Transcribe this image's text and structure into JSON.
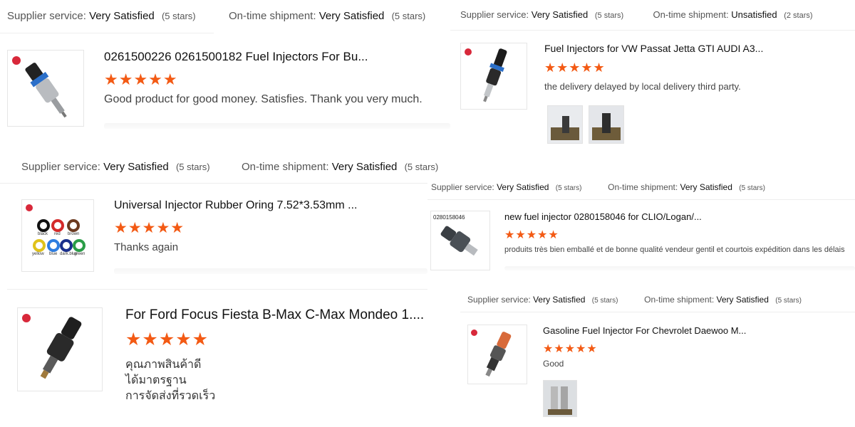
{
  "common": {
    "supplier_label": "Supplier service:",
    "shipment_label": "On-time shipment:",
    "very_satisfied": "Very Satisfied",
    "unsatisfied": "Unsatisfied",
    "five_stars_note": "(5 stars)",
    "two_stars_note": "(2 stars)",
    "star_glyphs": "★★★★★",
    "star_color": "#f35a14"
  },
  "reviews": [
    {
      "title": "0261500226 0261500182 Fuel Injectors For Bu...",
      "rating": 5,
      "text": "Good product for good money. Satisfies. Thank you very much.",
      "supplier": "Very Satisfied",
      "supplier_stars": "(5 stars)",
      "shipment": "Very Satisfied",
      "shipment_stars": "(5 stars)",
      "image_icon": "fuel-injector-silver-icon"
    },
    {
      "title": "Fuel Injectors for VW Passat Jetta GTI AUDI A3...",
      "rating": 5,
      "text": "the delivery delayed by local delivery third party.",
      "supplier": "Very Satisfied",
      "supplier_stars": "(5 stars)",
      "shipment": "Unsatisfied",
      "shipment_stars": "(2 stars)",
      "image_icon": "fuel-injector-black-icon",
      "photos": 2
    },
    {
      "title": "Universal Injector Rubber Oring 7.52*3.53mm ...",
      "rating": 5,
      "text": "Thanks again",
      "supplier": "Very Satisfied",
      "supplier_stars": "(5 stars)",
      "shipment": "Very Satisfied",
      "shipment_stars": "(5 stars)",
      "image_icon": "orings-icon",
      "oring_labels": [
        "black",
        "red",
        "brown",
        "yellow",
        "blue",
        "dark.blue",
        "green"
      ]
    },
    {
      "title": "new fuel injector 0280158046 for CLIO/Logan/...",
      "rating": 5,
      "text": "produits très bien emballé et de bonne qualité vendeur gentil et courtois expédition dans les délais",
      "supplier": "Very Satisfied",
      "supplier_stars": "(5 stars)",
      "shipment": "Very Satisfied",
      "shipment_stars": "(5 stars)",
      "image_icon": "fuel-injector-dark-icon",
      "image_caption": "0280158046"
    },
    {
      "title": "For Ford Focus Fiesta B-Max C-Max Mondeo 1....",
      "rating": 5,
      "text_lines": [
        "คุณภาพสินค้าดี",
        "ได้มาตรฐาน",
        "การจัดส่งที่รวดเร็ว"
      ],
      "image_icon": "fuel-injector-black-icon"
    },
    {
      "title": "Gasoline Fuel Injector For Chevrolet Daewoo M...",
      "rating": 5,
      "text": "Good",
      "supplier": "Very Satisfied",
      "supplier_stars": "(5 stars)",
      "shipment": "Very Satisfied",
      "shipment_stars": "(5 stars)",
      "image_icon": "fuel-injector-orange-icon",
      "photos": 1
    }
  ]
}
